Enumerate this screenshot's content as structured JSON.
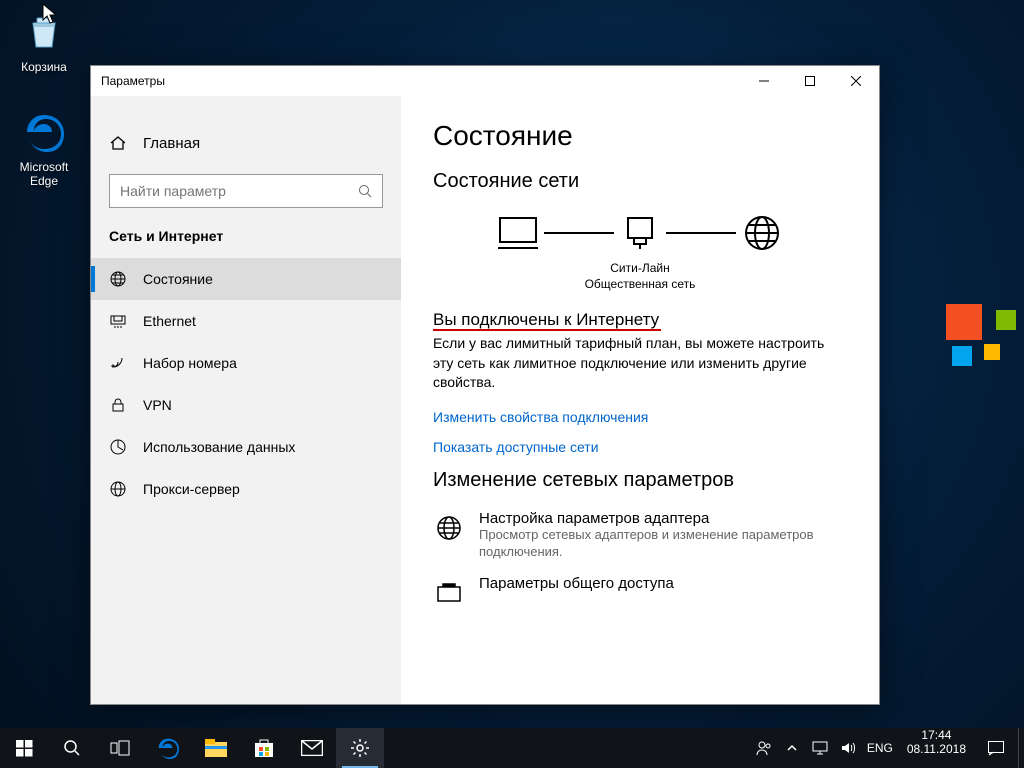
{
  "desktop": {
    "icons": [
      {
        "name": "recycle-bin",
        "label": "Корзина"
      },
      {
        "name": "microsoft-edge",
        "label": "Microsoft Edge"
      }
    ]
  },
  "window": {
    "title": "Параметры",
    "home_label": "Главная",
    "search_placeholder": "Найти параметр",
    "category": "Сеть и Интернет",
    "nav": [
      {
        "label": "Состояние",
        "active": true
      },
      {
        "label": "Ethernet"
      },
      {
        "label": "Набор номера"
      },
      {
        "label": "VPN"
      },
      {
        "label": "Использование данных"
      },
      {
        "label": "Прокси-сервер"
      }
    ],
    "content": {
      "heading": "Состояние",
      "section_status": "Состояние сети",
      "net_name": "Сити-Лайн",
      "net_type": "Общественная сеть",
      "connected_heading": "Вы подключены к Интернету",
      "connected_desc": "Если у вас лимитный тарифный план, вы можете настроить эту сеть как лимитное подключение или изменить другие свойства.",
      "link_change_props": "Изменить свойства подключения",
      "link_show_nets": "Показать доступные сети",
      "section_change": "Изменение сетевых параметров",
      "opt1_title": "Настройка параметров адаптера",
      "opt1_sub": "Просмотр сетевых адаптеров и изменение параметров подключения.",
      "opt2_title": "Параметры общего доступа"
    }
  },
  "taskbar": {
    "lang": "ENG",
    "time": "17:44",
    "date": "08.11.2018"
  }
}
